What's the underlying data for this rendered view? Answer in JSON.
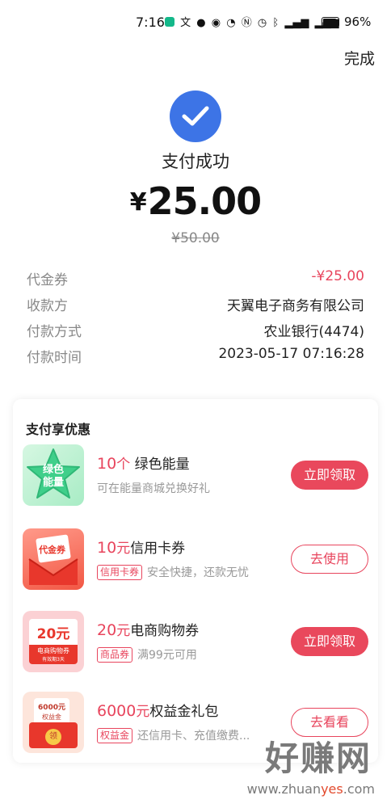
{
  "status_bar": {
    "time": "7:16",
    "battery": "96%",
    "icons": [
      "app-icon",
      "translate-icon",
      "chat-icon",
      "qq-icon",
      "speed-icon",
      "nfc-icon",
      "alarm-icon",
      "bluetooth-icon",
      "5g-signal-icon",
      "4g-signal-icon"
    ]
  },
  "header": {
    "done_label": "完成"
  },
  "payment": {
    "status": "支付成功",
    "currency": "¥",
    "amount": "25.00",
    "original_amount": "¥50.00"
  },
  "details": [
    {
      "label": "代金券",
      "value": "-¥25.00"
    },
    {
      "label": "收款方",
      "value": "天翼电子商务有限公司"
    },
    {
      "label": "付款方式",
      "value": "农业银行(4474)"
    },
    {
      "label": "付款时间",
      "value": "2023-05-17 07:16:28"
    }
  ],
  "offers": {
    "title": "支付享优惠",
    "items": [
      {
        "num": "10",
        "unit": "个",
        "name": "绿色能量",
        "tag": "",
        "sub": "可在能量商城兑换好礼",
        "button": "立即领取",
        "thumb_text": "绿色能量"
      },
      {
        "num": "10",
        "unit": "元",
        "name": "信用卡券",
        "tag": "信用卡券",
        "sub": "安全快捷，还款无忧",
        "button": "去使用",
        "thumb_text": "代金券"
      },
      {
        "num": "20",
        "unit": "元",
        "name": "电商购物券",
        "tag": "商品券",
        "sub": "满99元可用",
        "button": "立即领取",
        "thumb_text": "20元",
        "thumb_sub": "电商购物券",
        "thumb_sub2": "有效期3天"
      },
      {
        "num": "6000",
        "unit": "元",
        "name": "权益金礼包",
        "tag": "权益金",
        "sub": "还信用卡、充值缴费...",
        "button": "去看看",
        "thumb_text": "6000元",
        "thumb_sub": "权益金",
        "thumb_sub2": "领"
      }
    ]
  },
  "watermark": {
    "brand": "好赚网",
    "url_prefix": "www.zhuan",
    "url_accent": "yes",
    "url_suffix": ".com"
  },
  "colors": {
    "accent": "#e9485c",
    "success": "#3d74e6"
  }
}
